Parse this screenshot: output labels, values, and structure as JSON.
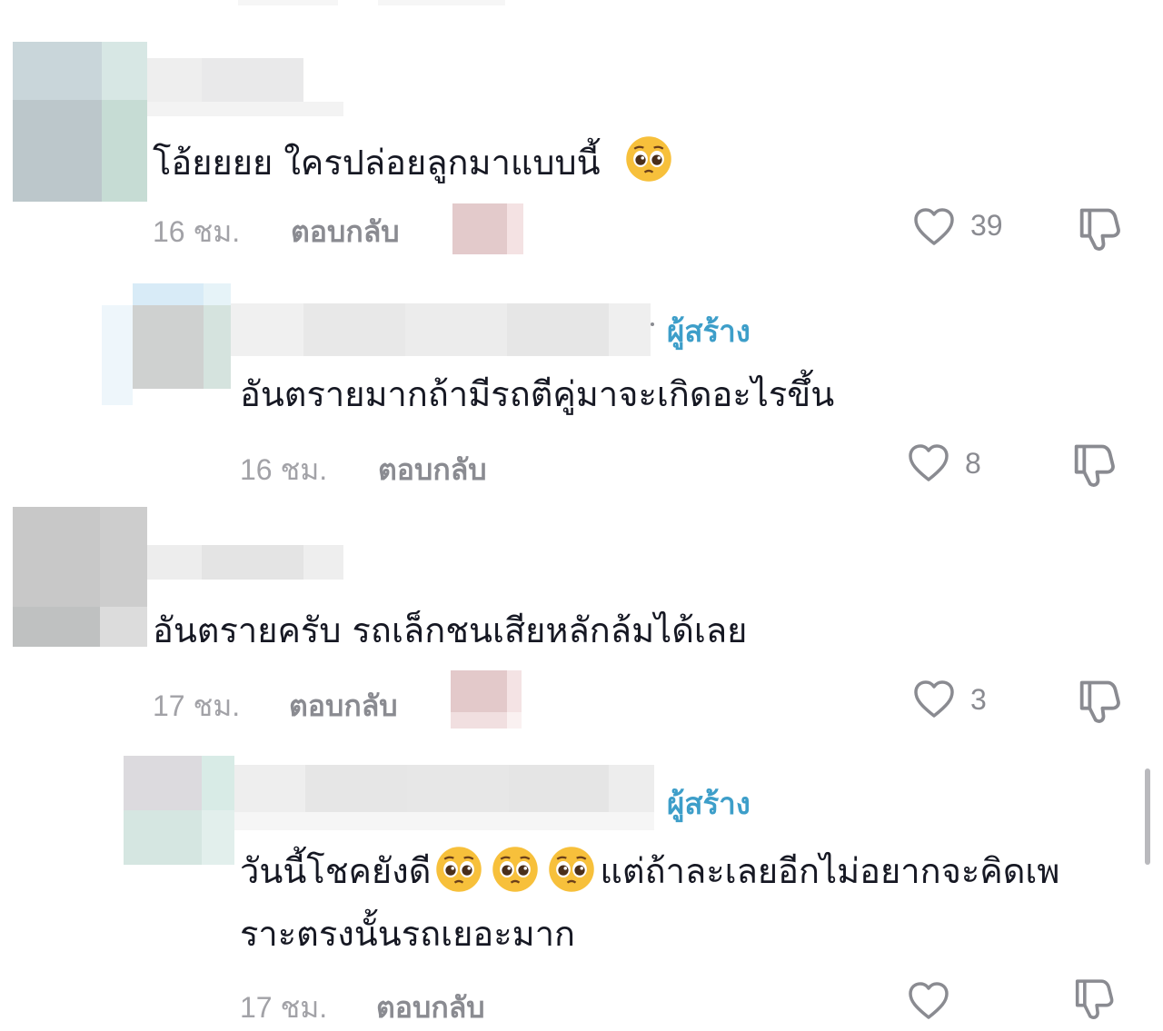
{
  "comments": [
    {
      "text": "โอ้ยยยย ใครปล่อยลูกมาแบบนี้",
      "emoji": [
        "pleading-face"
      ],
      "time": "16 ชม.",
      "reply_label": "ตอบกลับ",
      "likes": "39",
      "reply": {
        "badge": "ผู้สร้าง",
        "text": "อันตรายมากถ้ามีรถตีคู่มาจะเกิดอะไรขึ้น",
        "time": "16 ชม.",
        "reply_label": "ตอบกลับ",
        "likes": "8"
      }
    },
    {
      "text": "อันตรายครับ รถเล็กชนเสียหลักล้มได้เลย",
      "time": "17 ชม.",
      "reply_label": "ตอบกลับ",
      "likes": "3",
      "reply": {
        "badge": "ผู้สร้าง",
        "text_line1_start": "วันนี้โชคยังดี",
        "text_line1_end": "แต่ถ้าละเลยอีกไม่อยากจะคิดเพ",
        "text_line2": "ราะตรงนั้นรถเยอะมาก",
        "emoji": [
          "pleading-face",
          "pleading-face",
          "pleading-face"
        ],
        "time": "17 ชม.",
        "reply_label": "ตอบกลับ",
        "likes": ""
      }
    }
  ],
  "icons": {
    "like": "heart-outline-icon",
    "dislike": "thumbs-down-outline-icon"
  },
  "colors": {
    "creator_badge": "#3d9ec9",
    "secondary_text": "#8a8b91"
  }
}
